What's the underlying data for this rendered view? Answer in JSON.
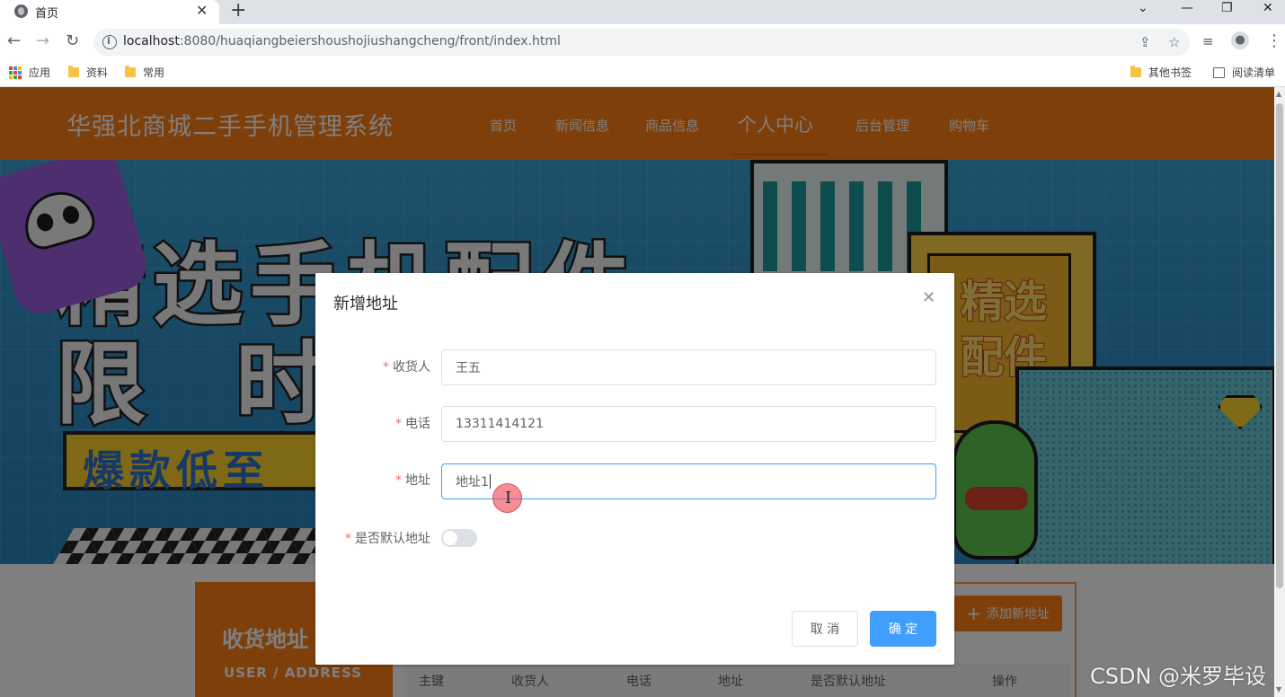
{
  "browser": {
    "tab_title": "首页",
    "url_host": "localhost",
    "url_rest": ":8080/huaqiangbeiershoushojiushangcheng/front/index.html",
    "bookmarks": [
      "应用",
      "资料",
      "常用"
    ],
    "bookmarks_right": [
      "其他书签",
      "阅读清单"
    ]
  },
  "site": {
    "title": "华强北商城二手手机管理系统",
    "nav": [
      "首页",
      "新闻信息",
      "商品信息",
      "个人中心",
      "后台管理",
      "购物车"
    ],
    "active_nav": "个人中心",
    "brand_color": "#ff7f14"
  },
  "banner": {
    "line1": "精选手机配件",
    "line2": "限时",
    "line3": "爆款低至",
    "side_text": "精选配件"
  },
  "address_section": {
    "title": "收货地址",
    "subtitle": "USER / ADDRESS",
    "add_button": "添加新地址",
    "columns": [
      "主键",
      "收货人",
      "电话",
      "地址",
      "是否默认地址",
      "操作"
    ]
  },
  "dialog": {
    "title": "新增地址",
    "fields": [
      {
        "label": "收货人",
        "value": "王五"
      },
      {
        "label": "电话",
        "value": "13311414121"
      },
      {
        "label": "地址",
        "value": "地址1"
      }
    ],
    "default_label": "是否默认地址",
    "default_on": false,
    "cancel": "取 消",
    "confirm": "确 定",
    "accent": "#409eff"
  },
  "watermark": "CSDN @米罗毕设"
}
